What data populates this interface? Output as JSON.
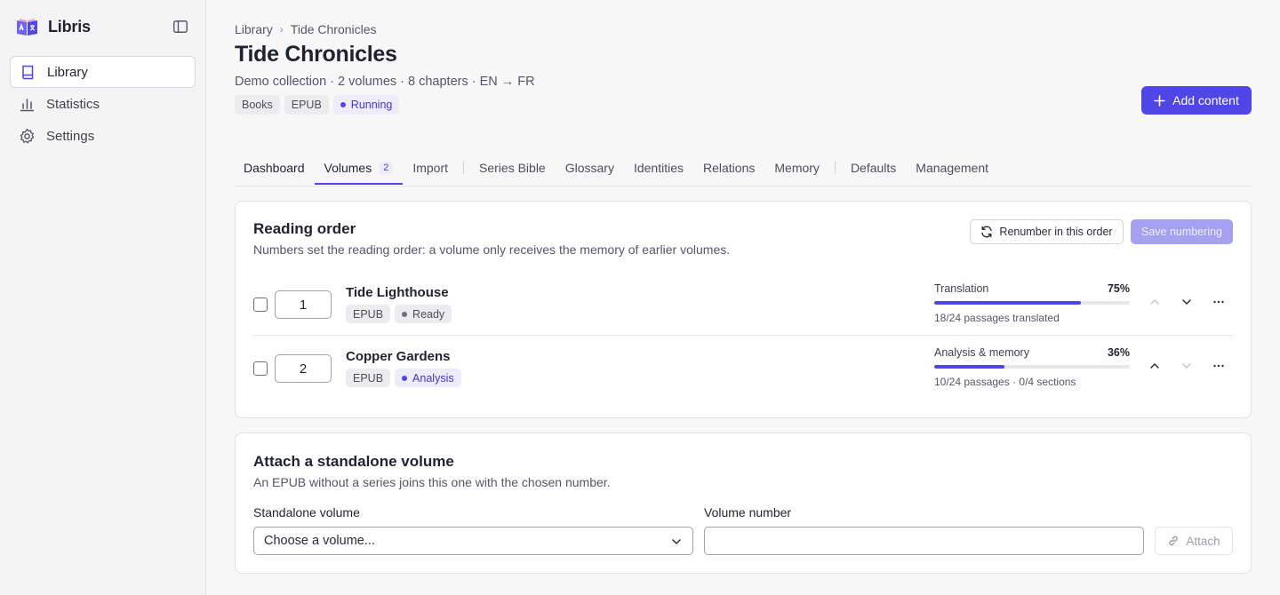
{
  "app": {
    "name": "Libris",
    "accent_color": "#4f46e5"
  },
  "sidebar": {
    "items": [
      {
        "label": "Library",
        "icon": "book-icon",
        "active": true
      },
      {
        "label": "Statistics",
        "icon": "bar-chart-icon",
        "active": false
      },
      {
        "label": "Settings",
        "icon": "gear-icon",
        "active": false
      }
    ]
  },
  "header": {
    "breadcrumb": [
      "Library",
      "Tide Chronicles"
    ],
    "title": "Tide Chronicles",
    "subtitle": "Demo collection · 2 volumes · 8 chapters · EN → FR",
    "badges": [
      "Books",
      "EPUB"
    ],
    "status": "Running",
    "add_button": "Add content"
  },
  "tabs": [
    {
      "label": "Dashboard"
    },
    {
      "label": "Volumes",
      "count": "2",
      "active": true
    },
    {
      "label": "Import"
    },
    {
      "label": "Series Bible"
    },
    {
      "label": "Glossary"
    },
    {
      "label": "Identities"
    },
    {
      "label": "Relations"
    },
    {
      "label": "Memory"
    },
    {
      "label": "Defaults"
    },
    {
      "label": "Management"
    }
  ],
  "reading_order": {
    "title": "Reading order",
    "description": "Numbers set the reading order: a volume only receives the memory of earlier volumes.",
    "renumber_button": "Renumber in this order",
    "save_button": "Save numbering",
    "volumes": [
      {
        "number": "1",
        "title": "Tide Lighthouse",
        "format": "EPUB",
        "status": "Ready",
        "progress_label": "Translation",
        "progress_pct_text": "75%",
        "progress_fraction": 0.75,
        "progress_detail": "18/24 passages translated"
      },
      {
        "number": "2",
        "title": "Copper Gardens",
        "format": "EPUB",
        "status": "Analysis",
        "progress_label": "Analysis & memory",
        "progress_pct_text": "36%",
        "progress_fraction": 0.36,
        "progress_detail": "10/24 passages · 0/4 sections"
      }
    ]
  },
  "attach": {
    "title": "Attach a standalone volume",
    "description": "An EPUB without a series joins this one with the chosen number.",
    "standalone_label": "Standalone volume",
    "standalone_value": "Choose a volume...",
    "number_label": "Volume number",
    "number_value": "",
    "attach_button": "Attach"
  }
}
